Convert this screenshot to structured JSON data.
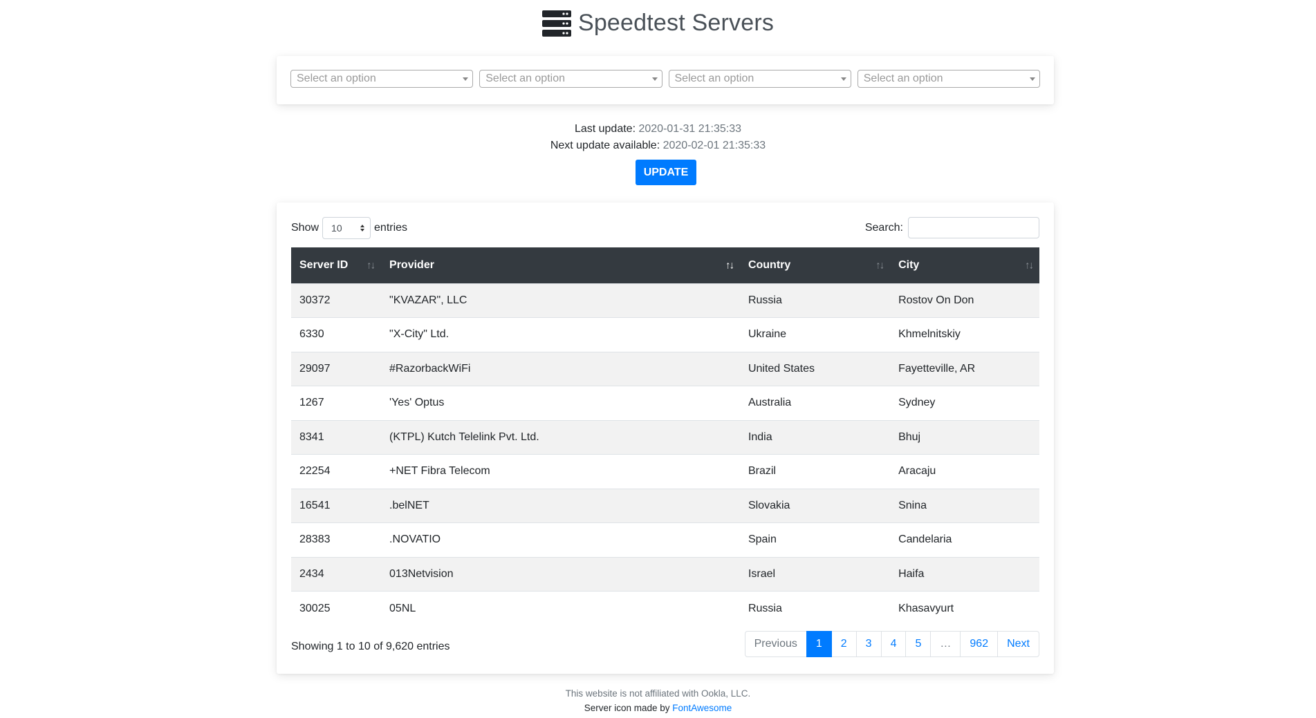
{
  "header": {
    "icon": "server-icon",
    "title": "Speedtest Servers"
  },
  "filters": [
    {
      "placeholder": "Select an option"
    },
    {
      "placeholder": "Select an option"
    },
    {
      "placeholder": "Select an option"
    },
    {
      "placeholder": "Select an option"
    }
  ],
  "update_info": {
    "last_label": "Last update:",
    "last_value": "2020-01-31 21:35:33",
    "next_label": "Next update available:",
    "next_value": "2020-02-01 21:35:33",
    "button_label": "UPDATE"
  },
  "table_controls": {
    "show_label": "Show",
    "entries_value": "10",
    "entries_label": "entries",
    "search_label": "Search:",
    "search_value": ""
  },
  "table": {
    "columns": [
      "Server ID",
      "Provider",
      "Country",
      "City"
    ],
    "sort_glyph": "↑↓",
    "rows": [
      [
        "30372",
        "\"KVAZAR\", LLC",
        "Russia",
        "Rostov On Don"
      ],
      [
        "6330",
        "\"X-City\" Ltd.",
        "Ukraine",
        "Khmelnitskiy"
      ],
      [
        "29097",
        "#RazorbackWiFi",
        "United States",
        "Fayetteville, AR"
      ],
      [
        "1267",
        "'Yes' Optus",
        "Australia",
        "Sydney"
      ],
      [
        "8341",
        "(KTPL) Kutch Telelink Pvt. Ltd.",
        "India",
        "Bhuj"
      ],
      [
        "22254",
        "+NET Fibra Telecom",
        "Brazil",
        "Aracaju"
      ],
      [
        "16541",
        ".belNET",
        "Slovakia",
        "Snina"
      ],
      [
        "28383",
        ".NOVATIO",
        "Spain",
        "Candelaria"
      ],
      [
        "2434",
        "013Netvision",
        "Israel",
        "Haifa"
      ],
      [
        "30025",
        "05NL",
        "Russia",
        "Khasavyurt"
      ]
    ]
  },
  "info_text": "Showing 1 to 10 of 9,620 entries",
  "pagination": {
    "previous": "Previous",
    "pages": [
      "1",
      "2",
      "3",
      "4",
      "5",
      "…",
      "962"
    ],
    "next": "Next",
    "active": "1"
  },
  "footer": {
    "disclaimer": "This website is not affiliated with Ookla, LLC.",
    "credit_prefix": "Server icon made by ",
    "credit_link": "FontAwesome"
  },
  "colors": {
    "accent": "#007bff",
    "table_header": "#343a40",
    "stripe": "#f2f2f2"
  }
}
